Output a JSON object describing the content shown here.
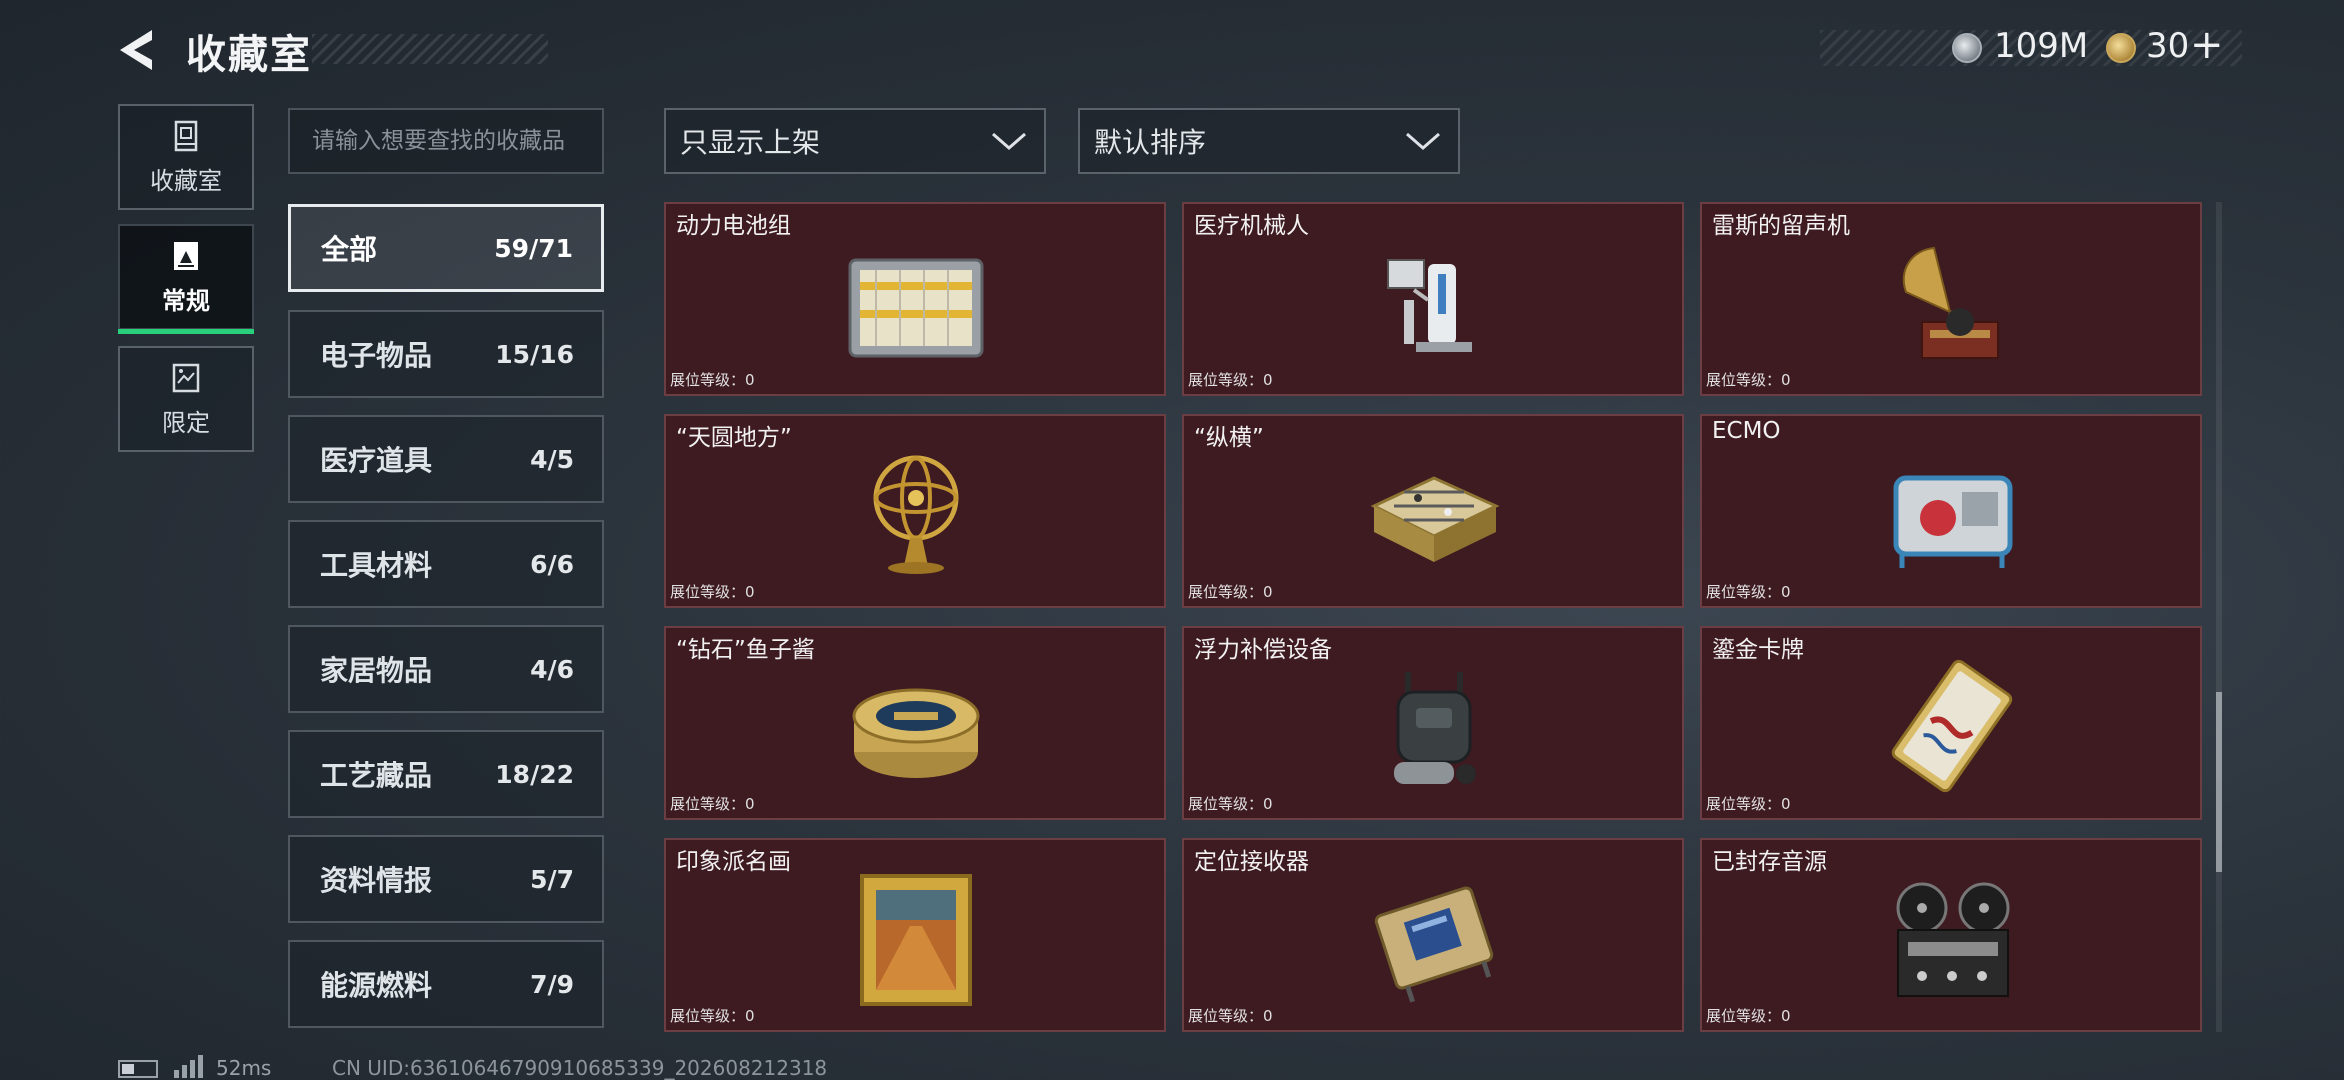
{
  "header": {
    "title": "收藏室",
    "currencies": [
      {
        "icon": "silver-coin-icon",
        "value": "109M"
      },
      {
        "icon": "gold-coin-icon",
        "value": "30"
      }
    ],
    "plus_label": "+"
  },
  "mode_tabs": [
    {
      "label": "收藏室",
      "icon": "collection-room-icon"
    },
    {
      "label": "常规",
      "icon": "regular-collection-icon",
      "active": true
    },
    {
      "label": "限定",
      "icon": "limited-collection-icon"
    }
  ],
  "search": {
    "placeholder": "请输入想要查找的收藏品"
  },
  "filters": {
    "shelf_filter": "只显示上架",
    "sort": "默认排序"
  },
  "categories": [
    {
      "name": "全部",
      "count": "59/71",
      "active": true
    },
    {
      "name": "电子物品",
      "count": "15/16"
    },
    {
      "name": "医疗道具",
      "count": "4/5"
    },
    {
      "name": "工具材料",
      "count": "6/6"
    },
    {
      "name": "家居物品",
      "count": "4/6"
    },
    {
      "name": "工艺藏品",
      "count": "18/22"
    },
    {
      "name": "资料情报",
      "count": "5/7"
    },
    {
      "name": "能源燃料",
      "count": "7/9"
    }
  ],
  "items": [
    {
      "name": "动力电池组",
      "level": "展位等级：0",
      "icon": "battery-pack-icon"
    },
    {
      "name": "医疗机械人",
      "level": "展位等级：0",
      "icon": "medical-robot-icon"
    },
    {
      "name": "雷斯的留声机",
      "level": "展位等级：0",
      "icon": "gramophone-icon"
    },
    {
      "name": "“天圆地方”",
      "level": "展位等级：0",
      "icon": "armillary-sphere-icon"
    },
    {
      "name": "“纵横”",
      "level": "展位等级：0",
      "icon": "chessboard-icon"
    },
    {
      "name": "ECMO",
      "level": "展位等级：0",
      "icon": "ecmo-machine-icon"
    },
    {
      "name": "“钻石”鱼子酱",
      "level": "展位等级：0",
      "icon": "caviar-tin-icon"
    },
    {
      "name": "浮力补偿设备",
      "level": "展位等级：0",
      "icon": "buoyancy-device-icon"
    },
    {
      "name": "鎏金卡牌",
      "level": "展位等级：0",
      "icon": "gilded-card-icon"
    },
    {
      "name": "印象派名画",
      "level": "展位等级：0",
      "icon": "framed-painting-icon"
    },
    {
      "name": "定位接收器",
      "level": "展位等级：0",
      "icon": "locator-receiver-icon"
    },
    {
      "name": "已封存音源",
      "level": "展位等级：0",
      "icon": "tape-recorder-icon"
    }
  ],
  "footer": {
    "ping": "52ms",
    "uid": "CN UID:6361064679091068533​9_202608212318"
  },
  "colors": {
    "card_bg": "#3e1a21",
    "accent_green": "#29d07b"
  }
}
